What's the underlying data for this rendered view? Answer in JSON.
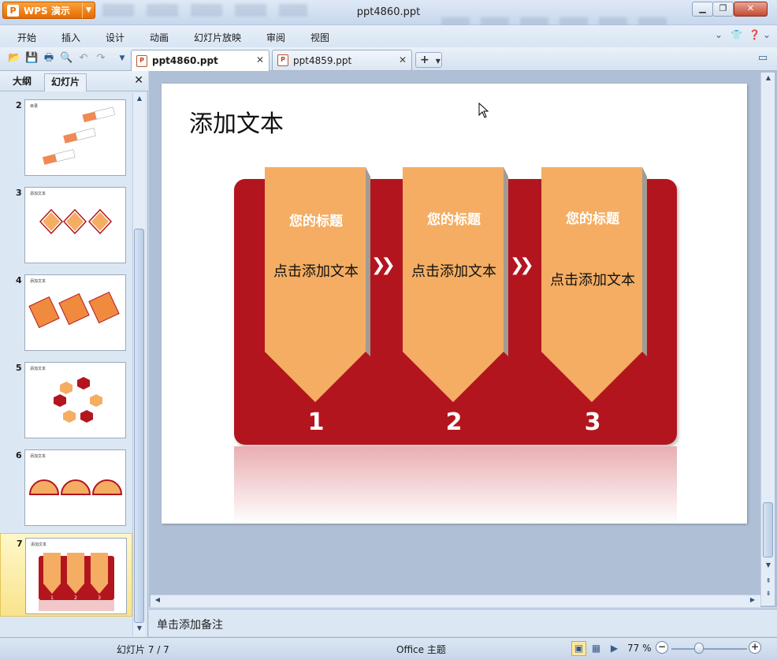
{
  "app": {
    "brand": "WPS 演示",
    "window_title": "ppt4860.ppt"
  },
  "menu": [
    "开始",
    "插入",
    "设计",
    "动画",
    "幻灯片放映",
    "审阅",
    "视图"
  ],
  "doc_tabs": [
    {
      "label": "ppt4860.ppt",
      "active": true
    },
    {
      "label": "ppt4859.ppt",
      "active": false
    }
  ],
  "panel": {
    "tabs": [
      "大纲",
      "幻灯片"
    ],
    "active_tab": "幻灯片"
  },
  "thumbnails": [
    {
      "num": "2",
      "title": "目录"
    },
    {
      "num": "3",
      "title": "添加文本"
    },
    {
      "num": "4",
      "title": "添加文本"
    },
    {
      "num": "5",
      "title": "添加文本"
    },
    {
      "num": "6",
      "title": "添加文本"
    },
    {
      "num": "7",
      "title": "添加文本",
      "selected": true
    }
  ],
  "slide": {
    "title": "添加文本",
    "cards": [
      {
        "title": "您的标题",
        "text": "点击添加文本",
        "number": "1"
      },
      {
        "title": "您的标题",
        "text": "点击添加文本",
        "number": "2"
      },
      {
        "title": "您的标题",
        "text": "点击添加文本",
        "number": "3"
      }
    ],
    "colors": {
      "panel": "#b3151f",
      "card": "#f4ad62",
      "card_shadow": "#a19b94"
    }
  },
  "notes": {
    "placeholder": "单击添加备注"
  },
  "status": {
    "slide_info": "幻灯片 7 / 7",
    "theme": "Office 主题",
    "zoom": "77 %",
    "zoom_level_percent": 77
  }
}
